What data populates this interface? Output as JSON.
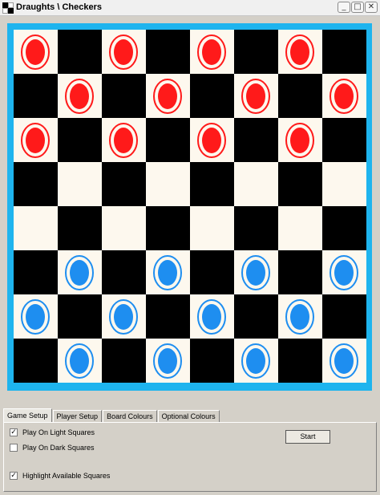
{
  "window": {
    "title": "Draughts \\ Checkers",
    "minimize_glyph": "_",
    "maximize_glyph": "□",
    "close_glyph": "✕"
  },
  "colors": {
    "board_border": "#1eb4ee",
    "light_square": "#fdf8ee",
    "dark_square": "#000000",
    "red_piece": "#ff1a1a",
    "blue_piece": "#1e8ef0"
  },
  "board": {
    "rows": [
      [
        "red",
        null,
        "red",
        null,
        "red",
        null,
        "red",
        null
      ],
      [
        null,
        "red",
        null,
        "red",
        null,
        "red",
        null,
        "red"
      ],
      [
        "red",
        null,
        "red",
        null,
        "red",
        null,
        "red",
        null
      ],
      [
        null,
        null,
        null,
        null,
        null,
        null,
        null,
        null
      ],
      [
        null,
        null,
        null,
        null,
        null,
        null,
        null,
        null
      ],
      [
        null,
        "blue",
        null,
        "blue",
        null,
        "blue",
        null,
        "blue"
      ],
      [
        "blue",
        null,
        "blue",
        null,
        "blue",
        null,
        "blue",
        null
      ],
      [
        null,
        "blue",
        null,
        "blue",
        null,
        "blue",
        null,
        "blue"
      ]
    ]
  },
  "tabs": [
    {
      "label": "Game Setup",
      "active": true
    },
    {
      "label": "Player Setup",
      "active": false
    },
    {
      "label": "Board Colours",
      "active": false
    },
    {
      "label": "Optional Colours",
      "active": false
    }
  ],
  "game_setup": {
    "play_on_light": {
      "label": "Play On Light Squares",
      "checked": true
    },
    "play_on_dark": {
      "label": "Play On Dark Squares",
      "checked": false
    },
    "highlight_available": {
      "label": "Highlight Available Squares",
      "checked": true
    },
    "check_mark": "✓",
    "start_label": "Start"
  }
}
